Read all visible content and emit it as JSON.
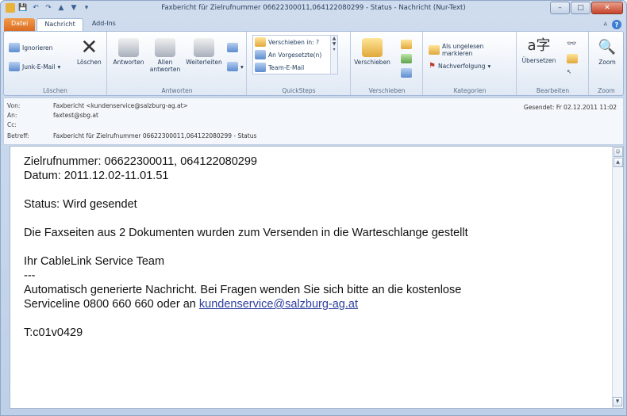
{
  "window": {
    "title": "Faxbericht für Zielrufnummer 06622300011,064122080299 - Status  -  Nachricht (Nur-Text)"
  },
  "tabs": [
    "Datei",
    "Nachricht",
    "Add-Ins"
  ],
  "ribbon": {
    "groups": {
      "loeschen": "Löschen",
      "antworten": "Antworten",
      "quicksteps": "QuickSteps",
      "verschieben": "Verschieben",
      "kategorien": "Kategorien",
      "bearbeiten": "Bearbeiten",
      "zoom": "Zoom"
    },
    "buttons": {
      "ignorieren": "Ignorieren",
      "junk": "Junk-E-Mail",
      "loeschen": "Löschen",
      "antworten": "Antworten",
      "allen": "Allen",
      "allen2": "antworten",
      "weiterleiten": "Weiterleiten",
      "qs1": "Verschieben in: ?",
      "qs2": "An Vorgesetzte(n)",
      "qs3": "Team-E-Mail",
      "verschieben": "Verschieben",
      "ungelesen": "Als ungelesen markieren",
      "nachverfolgung": "Nachverfolgung",
      "uebersetzen": "Übersetzen",
      "zoom": "Zoom"
    }
  },
  "header": {
    "von_label": "Von:",
    "von": "Faxbericht <kundenservice@salzburg-ag.at>",
    "an_label": "An:",
    "an": "faxtest@sbg.at",
    "cc_label": "Cc:",
    "cc": "",
    "betreff_label": "Betreff:",
    "betreff": "Faxbericht für Zielrufnummer 06622300011,064122080299 - Status",
    "gesendet": "Gesendet:   Fr 02.12.2011 11:02"
  },
  "message": {
    "line1": "Zielrufnummer: 06622300011, 064122080299",
    "line2": "Datum: 2011.12.02-11.01.51",
    "status": "Status: Wird gesendet",
    "info": "Die Faxseiten aus 2 Dokumenten wurden zum Versenden in die Warteschlange gestellt",
    "team": "Ihr CableLink Service Team",
    "separator": "---",
    "auto1": "Automatisch generierte Nachricht. Bei Fragen wenden Sie sich bitte an die kostenlose",
    "auto2": "Serviceline 0800 660 660 oder an ",
    "email": "kundenservice@salzburg-ag.at",
    "code": "T:c01v0429"
  }
}
